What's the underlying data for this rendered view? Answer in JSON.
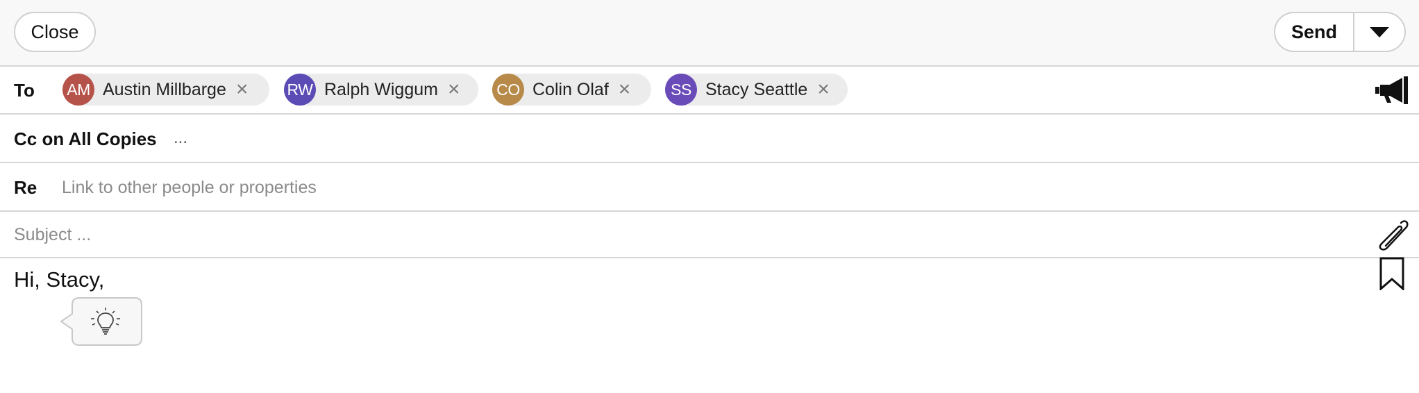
{
  "toolbar": {
    "close_label": "Close",
    "send_label": "Send",
    "send_more_icon": "caret-down-icon"
  },
  "recipients": {
    "label": "To",
    "chips": [
      {
        "initials": "AM",
        "name": "Austin Millbarge",
        "color": "#b5524a"
      },
      {
        "initials": "RW",
        "name": "Ralph Wiggum",
        "color": "#5b4cb5"
      },
      {
        "initials": "CO",
        "name": "Colin Olaf",
        "color": "#b88a4a"
      },
      {
        "initials": "SS",
        "name": "Stacy Seattle",
        "color": "#6a4cb8"
      }
    ],
    "broadcast_icon": "megaphone-icon"
  },
  "cc": {
    "label": "Cc on All Copies",
    "value": "..."
  },
  "re": {
    "label": "Re",
    "placeholder": "Link to other people or properties"
  },
  "subject": {
    "placeholder": "Subject ...",
    "attach_icon": "paperclip-icon"
  },
  "body": {
    "text": "Hi, Stacy,",
    "bookmark_icon": "bookmark-icon",
    "suggestion_icon": "lightbulb-icon"
  }
}
